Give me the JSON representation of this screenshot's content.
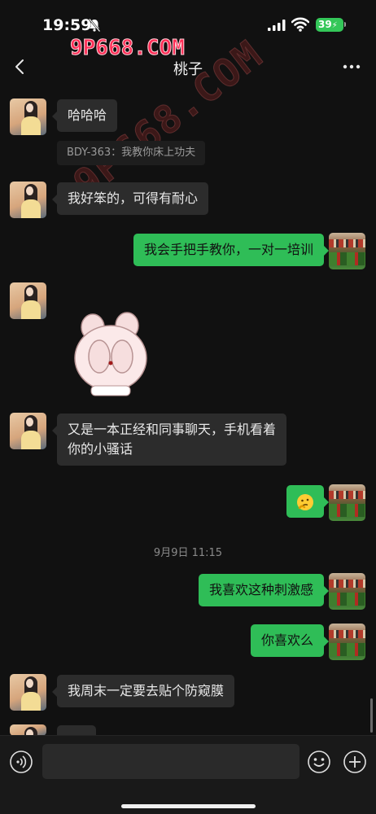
{
  "status_bar": {
    "time": "19:59",
    "battery": "39"
  },
  "watermark": {
    "top_text": "9P668.COM",
    "diagonal_text": "9P668.COM"
  },
  "nav": {
    "title": "桃子"
  },
  "messages": [
    {
      "side": "peer",
      "text": "哈哈哈"
    },
    {
      "side": "peer",
      "quote": "BDY-363：我教你床上功夫"
    },
    {
      "side": "peer",
      "text": "我好笨的，可得有耐心"
    },
    {
      "side": "self",
      "text": "我会手把手教你，一对一培训"
    },
    {
      "side": "peer",
      "type": "sticker",
      "sticker": "bunny-covering-face"
    },
    {
      "side": "peer",
      "lines": [
        "又是一本正经和同事聊天，手机看着",
        "你的小骚话"
      ]
    },
    {
      "side": "self",
      "type": "emoji",
      "emoji": "thinking-face"
    },
    {
      "type": "timestamp",
      "text": "9月9日 11:15"
    },
    {
      "side": "self",
      "text": "我喜欢这种刺激感"
    },
    {
      "side": "self",
      "text": "你喜欢么"
    },
    {
      "side": "peer",
      "text": "我周末一定要去贴个防窥膜"
    }
  ],
  "input": {
    "placeholder": ""
  },
  "icons": {
    "back": "chevron-left-icon",
    "more": "more-dots-icon",
    "voice": "voice-icon",
    "emoji": "emoji-icon",
    "plus": "plus-icon"
  },
  "colors": {
    "background": "#111111",
    "self_bubble": "#2fbd57",
    "peer_bubble": "#2c2c2c",
    "battery": "#34c759",
    "watermark": "#ff2d55"
  }
}
